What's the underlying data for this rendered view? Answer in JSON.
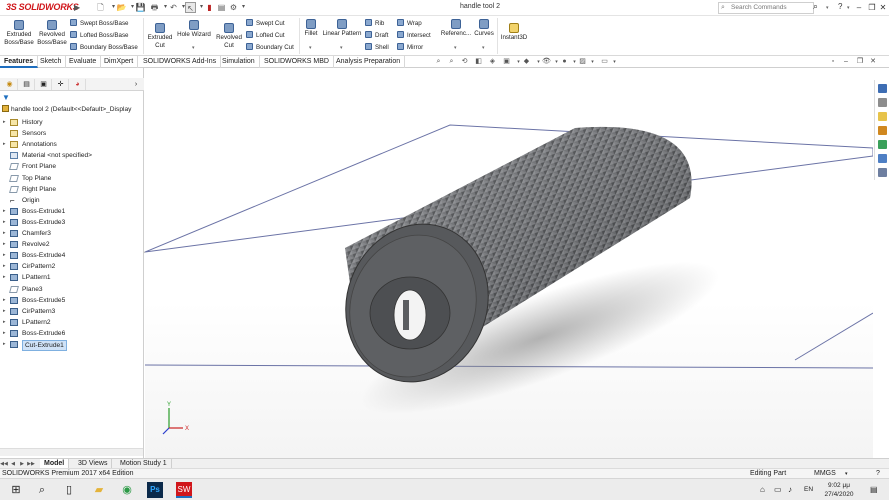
{
  "app": {
    "logo_prefix": "3S",
    "logo_name": "SOLIDWORKS",
    "document_title": "handle tool 2"
  },
  "search": {
    "placeholder": "Search Commands"
  },
  "ribbon": {
    "extruded_boss_base": "Extruded Boss/Base",
    "revolved_boss_base": "Revolved Boss/Base",
    "swept_boss_base": "Swept Boss/Base",
    "lofted_boss_base": "Lofted Boss/Base",
    "boundary_boss_base": "Boundary Boss/Base",
    "extruded_cut": "Extruded Cut",
    "hole_wizard": "Hole Wizard",
    "revolved_cut": "Revolved Cut",
    "swept_cut": "Swept Cut",
    "lofted_cut": "Lofted Cut",
    "boundary_cut": "Boundary Cut",
    "fillet": "Fillet",
    "linear_pattern": "Linear Pattern",
    "rib": "Rib",
    "draft": "Draft",
    "shell": "Shell",
    "wrap": "Wrap",
    "intersect": "Intersect",
    "mirror": "Mirror",
    "reference_geometry": "Referenc...",
    "curves": "Curves",
    "instant3d": "Instant3D"
  },
  "command_tabs": [
    "Features",
    "Sketch",
    "Evaluate",
    "DimXpert",
    "SOLIDWORKS Add-Ins",
    "Simulation",
    "SOLIDWORKS MBD",
    "Analysis Preparation"
  ],
  "tree": {
    "root": "handle tool 2  (Default<<Default>_Display",
    "items": [
      {
        "label": "History",
        "icon": "history-icon"
      },
      {
        "label": "Sensors",
        "icon": "sensors-icon"
      },
      {
        "label": "Annotations",
        "icon": "annotations-icon"
      },
      {
        "label": "Material <not specified>",
        "icon": "material-icon"
      },
      {
        "label": "Front Plane",
        "icon": "plane-icon"
      },
      {
        "label": "Top Plane",
        "icon": "plane-icon"
      },
      {
        "label": "Right Plane",
        "icon": "plane-icon"
      },
      {
        "label": "Origin",
        "icon": "origin-icon"
      },
      {
        "label": "Boss-Extrude1",
        "icon": "extrude-icon"
      },
      {
        "label": "Boss-Extrude3",
        "icon": "extrude-icon"
      },
      {
        "label": "Chamfer3",
        "icon": "chamfer-icon"
      },
      {
        "label": "Revolve2",
        "icon": "revolve-icon"
      },
      {
        "label": "Boss-Extrude4",
        "icon": "extrude-icon"
      },
      {
        "label": "CirPattern2",
        "icon": "pattern-icon"
      },
      {
        "label": "LPattern1",
        "icon": "pattern-icon"
      },
      {
        "label": "Plane3",
        "icon": "plane-icon"
      },
      {
        "label": "Boss-Extrude5",
        "icon": "extrude-icon"
      },
      {
        "label": "CirPattern3",
        "icon": "pattern-icon"
      },
      {
        "label": "LPattern2",
        "icon": "pattern-icon"
      },
      {
        "label": "Boss-Extrude6",
        "icon": "extrude-icon"
      },
      {
        "label": "Cut-Extrude1",
        "icon": "cut-extrude-icon"
      }
    ]
  },
  "bottom_tabs": [
    "Model",
    "3D Views",
    "Motion Study 1"
  ],
  "status": {
    "edition": "SOLIDWORKS Premium 2017 x64 Edition",
    "mode": "Editing Part",
    "units": "MMGS"
  },
  "taskbar": {
    "language": "EN",
    "time": "9:02 μμ",
    "date": "27/4/2020"
  },
  "triad": {
    "x": "X",
    "y": "Y"
  },
  "colors": {
    "brand_red": "#d0161b",
    "accent_blue": "#1e6ebf",
    "model_gray": "#5b5d60"
  }
}
